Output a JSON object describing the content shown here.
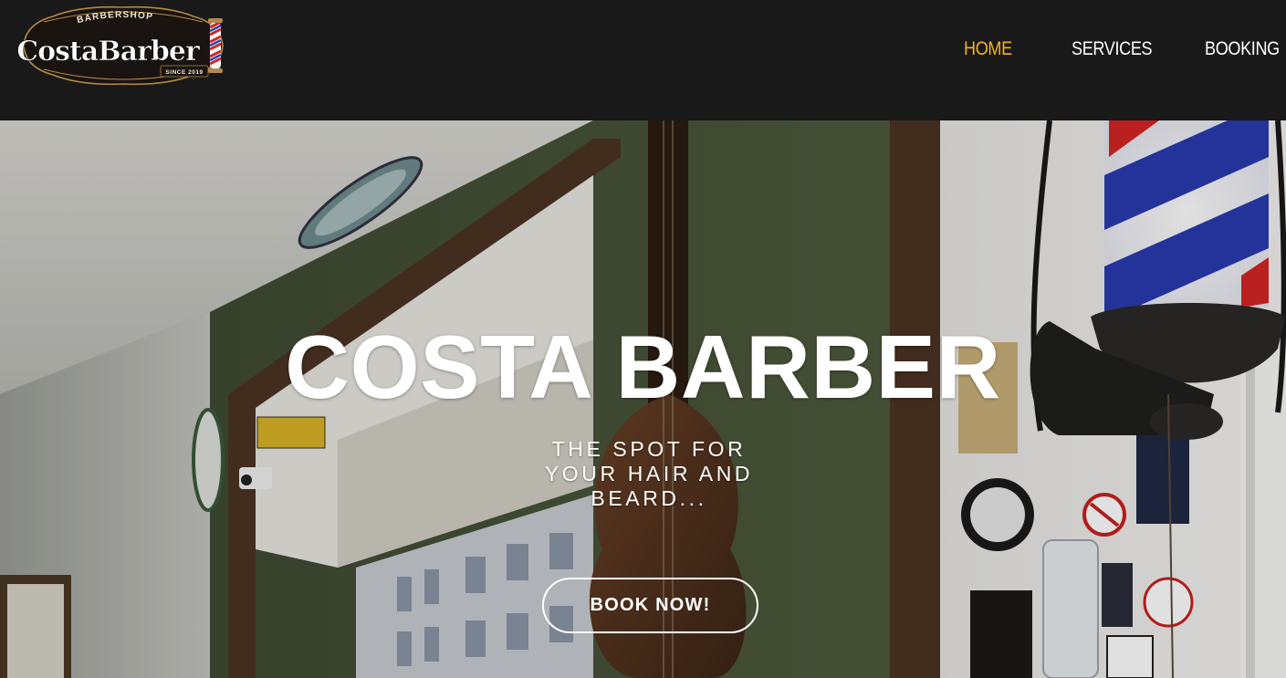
{
  "brand": {
    "logo_top_text": "BARBERSHOP",
    "logo_main_text": "CostaBarber",
    "logo_since_text": "SINCE 2019"
  },
  "nav": {
    "items": [
      {
        "label": "HOME",
        "active": true
      },
      {
        "label": "SERVICES",
        "active": false
      },
      {
        "label": "BOOKING",
        "active": false
      }
    ]
  },
  "hero": {
    "title": "COSTA BARBER",
    "subtitle_lines": [
      "THE SPOT FOR",
      "YOUR HAIR AND",
      "BEARD..."
    ],
    "cta_label": "BOOK NOW!"
  },
  "colors": {
    "header_bg": "#191919",
    "nav_active": "#f2b31e",
    "nav_text": "#ffffff",
    "cta_border": "#ffffff"
  }
}
